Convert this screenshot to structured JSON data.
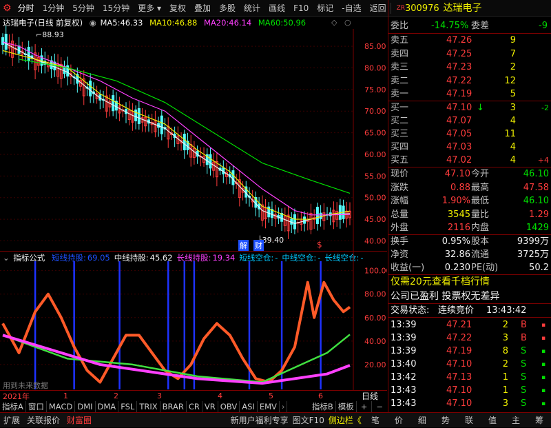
{
  "toolbar": {
    "left_items": [
      "分时",
      "1分钟",
      "5分钟",
      "15分钟",
      "更多"
    ],
    "right_items": [
      "复权",
      "叠加",
      "多股",
      "统计",
      "画线",
      "F10",
      "标记",
      "-自选",
      "返回"
    ]
  },
  "stock": {
    "badge": "ZR",
    "code": "300976",
    "name": "达瑞电子"
  },
  "main_chart": {
    "legend": {
      "title": "达瑞电子(日线 前复权)",
      "ma5_label": "MA5:",
      "ma5": "46.33",
      "ma10_label": "MA10:",
      "ma10": "46.88",
      "ma20_label": "MA20:",
      "ma20": "46.14",
      "ma60_label": "MA60:",
      "ma60": "50.96"
    },
    "high_label": "88.93",
    "low_label": "39.40",
    "markers": [
      "解",
      "财",
      "$"
    ]
  },
  "indicator": {
    "name": "指标公式",
    "items": [
      {
        "label": "短线持股:",
        "value": "69.05",
        "color": "#1e50ff"
      },
      {
        "label": "中线持股:",
        "value": "45.62",
        "color": "#f0f0f0"
      },
      {
        "label": "长线持股:",
        "value": "19.34",
        "color": "#ff40ff"
      },
      {
        "label": "短线空仓:",
        "value": "-",
        "color": "#00c8ff"
      },
      {
        "label": "中线空仓:",
        "value": "-",
        "color": "#00c8ff"
      },
      {
        "label": "长线空仓:",
        "value": "-",
        "color": "#00c8ff"
      }
    ],
    "note": "用到未来数据"
  },
  "chart_data": [
    {
      "type": "line",
      "title": "",
      "y_ticks": [
        85.0,
        80.0,
        75.0,
        70.0,
        65.0,
        60.0,
        55.0,
        50.0,
        45.0,
        40.0
      ],
      "ylim": [
        38.0,
        89.0
      ],
      "series": [
        {
          "name": "MA5",
          "color": "#f0f0f0",
          "x": [
            0,
            5,
            10,
            20,
            30,
            40,
            50,
            60,
            70,
            80,
            90,
            95,
            100,
            107
          ],
          "values": [
            86,
            84,
            82,
            79,
            73,
            69,
            66,
            60,
            55,
            47,
            44,
            45,
            46,
            46.3
          ]
        },
        {
          "name": "MA10",
          "color": "#f0f000",
          "x": [
            0,
            5,
            10,
            20,
            30,
            40,
            50,
            60,
            70,
            80,
            90,
            95,
            100,
            107
          ],
          "values": [
            84,
            83,
            82,
            80,
            74,
            70,
            67,
            61,
            56,
            48,
            45,
            45,
            46,
            46.9
          ]
        },
        {
          "name": "MA20",
          "color": "#ff40ff",
          "x": [
            0,
            5,
            10,
            20,
            30,
            40,
            50,
            60,
            70,
            80,
            90,
            95,
            100,
            107
          ],
          "values": [
            86,
            85,
            83,
            80,
            77,
            73,
            70,
            64,
            58,
            52,
            47,
            46,
            46,
            46.1
          ]
        },
        {
          "name": "MA60",
          "color": "#00e000",
          "x": [
            5,
            20,
            35,
            50,
            65,
            80,
            95,
            107
          ],
          "values": [
            82,
            80,
            77,
            72,
            65,
            58,
            54,
            51
          ]
        }
      ]
    },
    {
      "type": "line",
      "title": "",
      "y_ticks": [
        100.0,
        80.0,
        60.0,
        40.0,
        20.0
      ],
      "ylim": [
        0,
        108
      ],
      "signal_x": [
        10,
        22,
        36,
        51,
        56,
        59,
        76,
        86,
        98
      ],
      "series": [
        {
          "name": "短线持股",
          "color": "#ff5a28",
          "x": [
            0,
            5,
            10,
            14,
            18,
            22,
            26,
            30,
            34,
            38,
            42,
            46,
            50,
            54,
            58,
            62,
            66,
            70,
            74,
            78,
            82,
            86,
            90,
            94,
            96,
            99,
            102,
            105,
            107
          ],
          "values": [
            55,
            30,
            65,
            80,
            60,
            35,
            15,
            5,
            25,
            45,
            45,
            30,
            15,
            8,
            20,
            42,
            55,
            45,
            25,
            8,
            5,
            15,
            35,
            90,
            60,
            90,
            75,
            65,
            69
          ]
        },
        {
          "name": "中线持股",
          "color": "#e0e0e0",
          "x": [
            0,
            20,
            40,
            60,
            80,
            100,
            107
          ],
          "values": [
            45,
            25,
            20,
            10,
            5,
            30,
            45.6
          ]
        },
        {
          "name": "长线持股",
          "color": "#ff40ff",
          "x": [
            0,
            30,
            60,
            80,
            100,
            107
          ],
          "values": [
            45,
            20,
            8,
            4,
            12,
            19.3
          ]
        }
      ]
    }
  ],
  "axis_bottom": {
    "year": "2021年",
    "months": [
      "1",
      "2",
      "3",
      "4",
      "5",
      "6"
    ],
    "period": "日线"
  },
  "tabs": [
    "指标A",
    "窗口",
    "MACD",
    "DMI",
    "DMA",
    "FSL",
    "TRIX",
    "BRAR",
    "CR",
    "VR",
    "OBV",
    "ASI",
    "EMV"
  ],
  "tabs_right": [
    "指标B",
    "模板",
    "+",
    "−"
  ],
  "bottom_left": [
    "扩展",
    "关联报价",
    "财富圈"
  ],
  "bottom_right": [
    "新用户福利专享",
    "图文F10",
    "侧边栏"
  ],
  "right_tabs": [
    "笔",
    "价",
    "细",
    "势",
    "联",
    "值",
    "主",
    "筹"
  ],
  "quote": {
    "weibi_label": "委比",
    "weibi": "-14.75%",
    "weicha_label": "委差",
    "weicha": "-9",
    "asks": [
      {
        "label": "卖五",
        "price": "47.26",
        "vol": "9"
      },
      {
        "label": "卖四",
        "price": "47.25",
        "vol": "7"
      },
      {
        "label": "卖三",
        "price": "47.23",
        "vol": "2"
      },
      {
        "label": "卖二",
        "price": "47.22",
        "vol": "12"
      },
      {
        "label": "卖一",
        "price": "47.19",
        "vol": "5"
      }
    ],
    "bids": [
      {
        "label": "买一",
        "price": "47.10",
        "vol": "3",
        "chg": "-2",
        "chgcolor": "green",
        "arrow": "↓"
      },
      {
        "label": "买二",
        "price": "47.07",
        "vol": "4",
        "chg": "",
        "chgcolor": "",
        "arrow": ""
      },
      {
        "label": "买三",
        "price": "47.05",
        "vol": "11",
        "chg": "",
        "chgcolor": "",
        "arrow": ""
      },
      {
        "label": "买四",
        "price": "47.03",
        "vol": "4",
        "chg": "",
        "chgcolor": "",
        "arrow": ""
      },
      {
        "label": "买五",
        "price": "47.02",
        "vol": "4",
        "chg": "+4",
        "chgcolor": "red",
        "arrow": ""
      }
    ],
    "stats": [
      {
        "l1": "现价",
        "v1": "47.10",
        "c1": "red",
        "l2": "今开",
        "v2": "46.10",
        "c2": "green"
      },
      {
        "l1": "涨跌",
        "v1": "0.88",
        "c1": "red",
        "l2": "最高",
        "v2": "47.58",
        "c2": "red"
      },
      {
        "l1": "涨幅",
        "v1": "1.90%",
        "c1": "red",
        "l2": "最低",
        "v2": "46.10",
        "c2": "green"
      },
      {
        "l1": "总量",
        "v1": "3545",
        "c1": "yellow",
        "l2": "量比",
        "v2": "1.29",
        "c2": "red"
      },
      {
        "l1": "外盘",
        "v1": "2116",
        "c1": "red",
        "l2": "内盘",
        "v2": "1429",
        "c2": "green"
      }
    ],
    "stats2": [
      {
        "l1": "换手",
        "v1": "0.95%",
        "l2": "股本",
        "v2": "9399万"
      },
      {
        "l1": "净资",
        "v1": "32.86",
        "l2": "流通",
        "v2": "3725万"
      },
      {
        "l1": "收益(一)",
        "v1": "0.230",
        "l2": "PE(动)",
        "v2": "50.2"
      }
    ],
    "promo": "仅需20元查看千档行情",
    "notice": "公司已盈利 投票权无差异",
    "trade_status_label": "交易状态:",
    "trade_status": "连续竞价",
    "trade_time": "13:43:42",
    "ticks": [
      {
        "time": "13:39",
        "price": "47.21",
        "vol": "2",
        "side": "B",
        "flag": "▪"
      },
      {
        "time": "13:39",
        "price": "47.22",
        "vol": "3",
        "side": "B",
        "flag": "▪"
      },
      {
        "time": "13:39",
        "price": "47.19",
        "vol": "8",
        "side": "S",
        "flag": "▪"
      },
      {
        "time": "13:40",
        "price": "47.10",
        "vol": "2",
        "side": "S",
        "flag": "▪"
      },
      {
        "time": "13:42",
        "price": "47.13",
        "vol": "1",
        "side": "S",
        "flag": "▪"
      },
      {
        "time": "13:43",
        "price": "47.10",
        "vol": "1",
        "side": "S",
        "flag": "▪"
      },
      {
        "time": "13:43",
        "price": "47.10",
        "vol": "3",
        "side": "S",
        "flag": "▪"
      }
    ]
  }
}
